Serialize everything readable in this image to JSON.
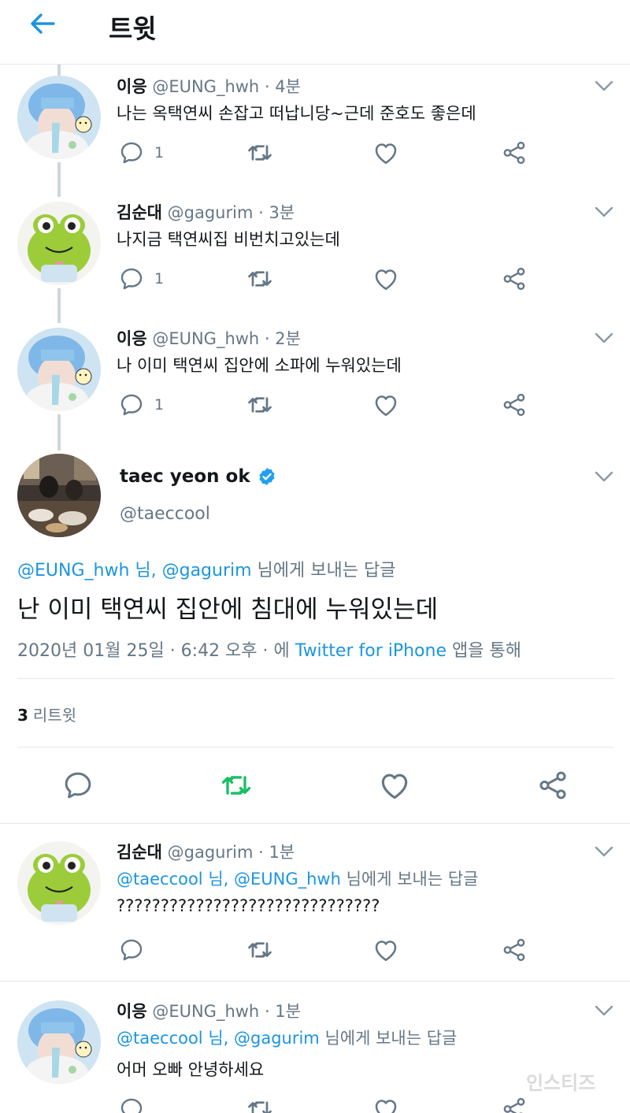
{
  "header": {
    "title": "트윗"
  },
  "tweets": [
    {
      "name": "이응",
      "handle": "@EUNG_hwh",
      "time": "· 4분",
      "text": "나는 옥택연씨 손잡고 떠납니당~근데 준호도 좋은데",
      "reply_count": "1"
    },
    {
      "name": "김순대",
      "handle": "@gagurim",
      "time": "· 3분",
      "text": "나지금 택연씨집 비번치고있는데",
      "reply_count": "1"
    },
    {
      "name": "이응",
      "handle": "@EUNG_hwh",
      "time": "· 2분",
      "text": "나 이미 택연씨 집안에 소파에 누워있는데",
      "reply_count": "1"
    }
  ],
  "main_tweet": {
    "name": "taec yeon ok",
    "handle": "@taeccool",
    "reply_mentions": "@EUNG_hwh 님, @gagurim",
    "reply_suffix": " 님에게 보내는 답글",
    "text": "난 이미 택연씨 집안에 침대에 누워있는데",
    "date": "2020년 01월 25일 · 6:42 오후 · 에 ",
    "source": "Twitter for iPhone",
    "source_suffix": " 앱을 통해",
    "retweet_count": "3",
    "retweet_label": "리트윗"
  },
  "replies": [
    {
      "name": "김순대",
      "handle": "@gagurim",
      "time": "· 1분",
      "reply_mentions": "@taeccool 님, @EUNG_hwh",
      "reply_suffix": " 님에게 보내는 답글",
      "text": "??????????????????????????????"
    },
    {
      "name": "이응",
      "handle": "@EUNG_hwh",
      "time": "· 1분",
      "reply_mentions": "@taeccool 님, @gagurim",
      "reply_suffix": " 님에게 보내는 답글",
      "text": "어머 오빠 안녕하세요"
    }
  ],
  "watermark": "인스티즈",
  "colors": {
    "accent": "#1b95e0",
    "retweet_active": "#17bf63",
    "muted": "#657786",
    "divider": "#e1e8ed"
  },
  "icons": [
    "back-arrow-icon",
    "reply-icon",
    "retweet-icon",
    "like-icon",
    "share-icon",
    "chevron-down-icon",
    "verified-badge-icon"
  ]
}
